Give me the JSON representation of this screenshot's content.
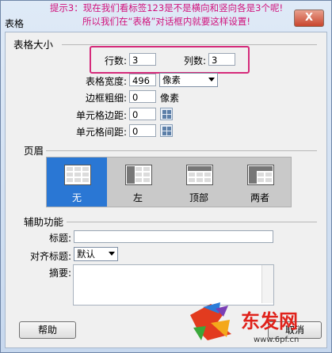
{
  "hint": {
    "line1": "提示3：现在我们看标签123是不是横向和竖向各是3个呢!",
    "line2": "所以我们在“表格”对话框内就要这样设置!"
  },
  "window": {
    "title": "表格",
    "close_label": "X"
  },
  "size_section": {
    "title": "表格大小",
    "rows_label": "行数:",
    "rows_value": "3",
    "cols_label": "列数:",
    "cols_value": "3",
    "width_label": "表格宽度:",
    "width_value": "496",
    "width_unit": "像素",
    "border_label": "边框粗细:",
    "border_value": "0",
    "border_unit": "像素",
    "padding_label": "单元格边距:",
    "padding_value": "0",
    "spacing_label": "单元格间距:",
    "spacing_value": "0"
  },
  "header_section": {
    "title": "页眉",
    "options": [
      {
        "label": "无",
        "selected": true
      },
      {
        "label": "左",
        "selected": false
      },
      {
        "label": "顶部",
        "selected": false
      },
      {
        "label": "两者",
        "selected": false
      }
    ]
  },
  "accessibility_section": {
    "title": "辅助功能",
    "caption_label": "标题:",
    "caption_value": "",
    "align_label": "对齐标题:",
    "align_value": "默认",
    "summary_label": "摘要:",
    "summary_value": ""
  },
  "buttons": {
    "help": "帮助",
    "cancel": "取消"
  },
  "watermark": {
    "logo_text": "东发网",
    "url": "www.6pf.cn"
  },
  "colors": {
    "selected_tab": "#2a77d4",
    "highlight_border": "#d52a7a",
    "hint_text": "#d1127c"
  }
}
